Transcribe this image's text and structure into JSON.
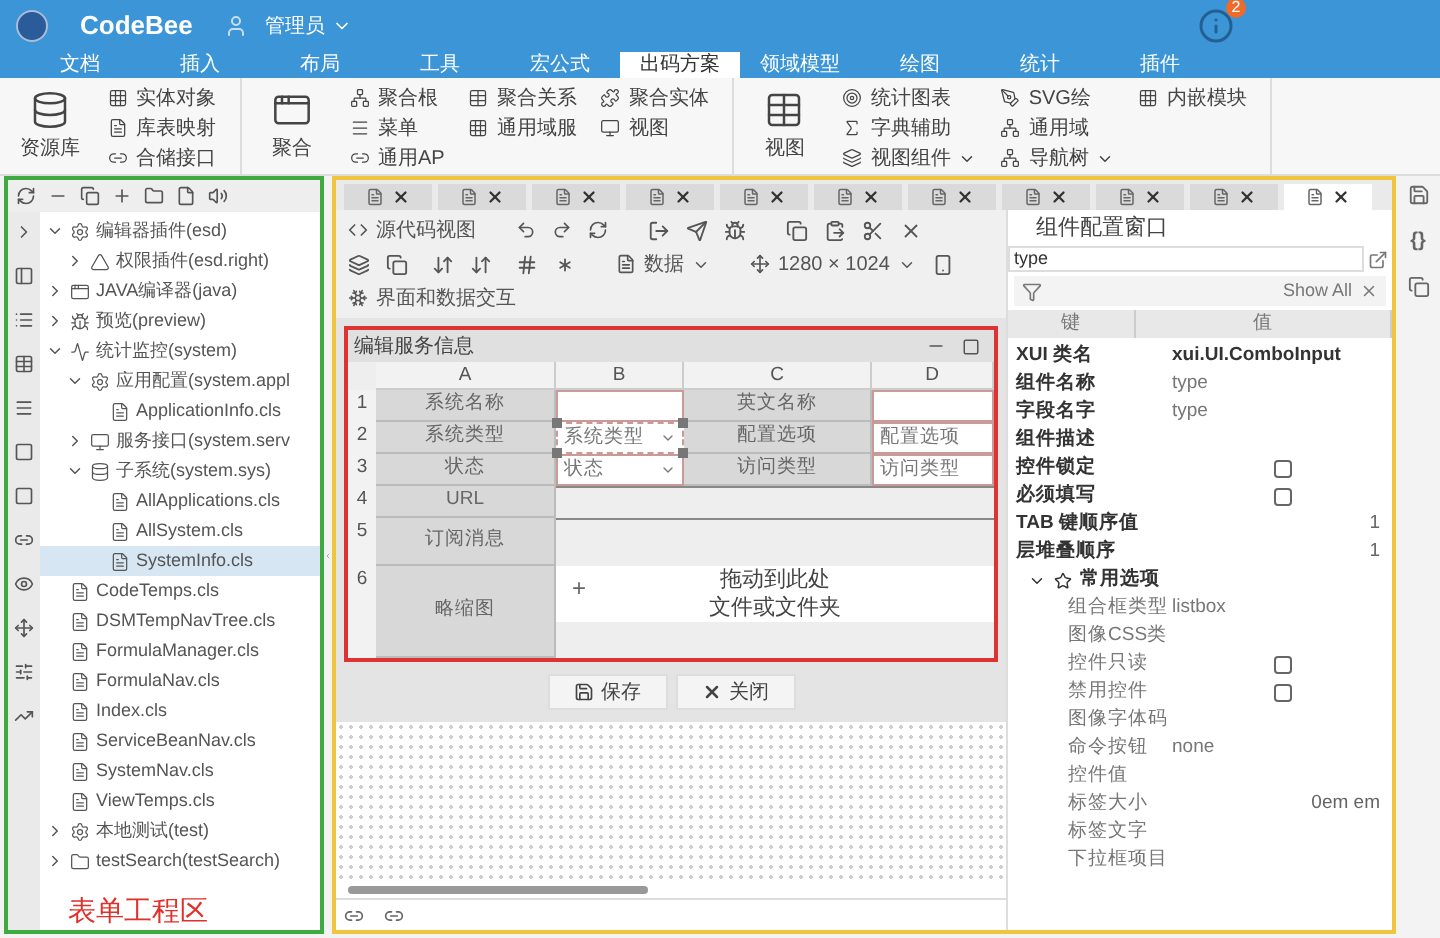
{
  "header": {
    "app_name": "CodeBee",
    "user": "管理员",
    "notification_count": "2"
  },
  "ribbon": {
    "tabs": [
      {
        "label": "文档",
        "selected": false
      },
      {
        "label": "插入",
        "selected": false
      },
      {
        "label": "布局",
        "selected": false
      },
      {
        "label": "工具",
        "selected": false
      },
      {
        "label": "宏公式",
        "selected": false
      },
      {
        "label": "出码方案",
        "selected": true
      },
      {
        "label": "领域模型",
        "selected": false
      },
      {
        "label": "绘图",
        "selected": false
      },
      {
        "label": "统计",
        "selected": false
      },
      {
        "label": "插件",
        "selected": false
      }
    ],
    "groups": [
      {
        "large": {
          "label": "资源库"
        },
        "columns": [
          [
            {
              "label": "实体对象",
              "dropdown": false
            },
            {
              "label": "库表映射",
              "dropdown": false
            },
            {
              "label": "合储接口",
              "dropdown": false
            }
          ]
        ]
      },
      {
        "large": {
          "label": "聚合"
        },
        "columns": [
          [
            {
              "label": "聚合根",
              "dropdown": false
            },
            {
              "label": "菜单",
              "dropdown": false
            },
            {
              "label": "通用AP",
              "dropdown": false
            }
          ],
          [
            {
              "label": "聚合关系",
              "dropdown": false
            },
            {
              "label": "通用域服",
              "dropdown": false
            }
          ],
          [
            {
              "label": "聚合实体",
              "dropdown": false
            },
            {
              "label": "视图",
              "dropdown": false
            }
          ]
        ]
      },
      {
        "large": {
          "label": "视图"
        },
        "columns": [
          [
            {
              "label": "统计图表",
              "dropdown": false
            },
            {
              "label": "字典辅助",
              "dropdown": false
            },
            {
              "label": "视图组件",
              "dropdown": true
            }
          ],
          [
            {
              "label": "SVG绘",
              "dropdown": false
            },
            {
              "label": "通用域",
              "dropdown": false
            },
            {
              "label": "导航树",
              "dropdown": true
            }
          ],
          [
            {
              "label": "内嵌模块",
              "dropdown": false
            }
          ]
        ]
      }
    ]
  },
  "project_tree": {
    "annotation": "表单工程区",
    "items": [
      {
        "label": "编辑器插件(esd)",
        "kind": "plugin",
        "selected": false,
        "expanded": true,
        "children": [
          {
            "label": "权限插件(esd.right)",
            "kind": "permission",
            "selected": false,
            "expanded": false
          }
        ]
      },
      {
        "label": "JAVA编译器(java)",
        "kind": "compiler",
        "selected": false,
        "expanded": false
      },
      {
        "label": "预览(preview)",
        "kind": "preview",
        "selected": false,
        "expanded": false
      },
      {
        "label": "统计监控(system)",
        "kind": "monitoring",
        "selected": false,
        "expanded": true,
        "children": [
          {
            "label": "应用配置(system.appl",
            "kind": "plugin",
            "selected": false,
            "expanded": true,
            "children": [
              {
                "label": "ApplicationInfo.cls",
                "kind": "file",
                "selected": false
              }
            ]
          },
          {
            "label": "服务接口(system.serv",
            "kind": "service",
            "selected": false,
            "expanded": false
          },
          {
            "label": "子系统(system.sys)",
            "kind": "database",
            "selected": false,
            "expanded": true,
            "children": [
              {
                "label": "AllApplications.cls",
                "kind": "file",
                "selected": false
              },
              {
                "label": "AllSystem.cls",
                "kind": "file",
                "selected": false
              },
              {
                "label": "SystemInfo.cls",
                "kind": "file",
                "selected": true
              }
            ]
          }
        ]
      },
      {
        "label": "CodeTemps.cls",
        "kind": "file",
        "selected": false
      },
      {
        "label": "DSMTempNavTree.cls",
        "kind": "file",
        "selected": false
      },
      {
        "label": "FormulaManager.cls",
        "kind": "file",
        "selected": false
      },
      {
        "label": "FormulaNav.cls",
        "kind": "file",
        "selected": false
      },
      {
        "label": "Index.cls",
        "kind": "file",
        "selected": false
      },
      {
        "label": "ServiceBeanNav.cls",
        "kind": "file",
        "selected": false
      },
      {
        "label": "SystemNav.cls",
        "kind": "file",
        "selected": false
      },
      {
        "label": "ViewTemps.cls",
        "kind": "file",
        "selected": false
      },
      {
        "label": "本地测试(test)",
        "kind": "plugin",
        "selected": false,
        "expanded": false
      },
      {
        "label": "testSearch(testSearch)",
        "kind": "folder",
        "selected": false,
        "expanded": false
      }
    ]
  },
  "editor": {
    "tabs": [
      {
        "selected": false
      },
      {
        "selected": false
      },
      {
        "selected": false
      },
      {
        "selected": false
      },
      {
        "selected": false
      },
      {
        "selected": false
      },
      {
        "selected": false
      },
      {
        "selected": false
      },
      {
        "selected": false
      },
      {
        "selected": false
      },
      {
        "selected": true
      }
    ],
    "toolbar": {
      "source_view": "源代码视图",
      "data_menu": "数据",
      "resolution": "1280 × 1024",
      "interaction": "界面和数据交互"
    },
    "form": {
      "title": "编辑服务信息",
      "columns": [
        "A",
        "B",
        "C",
        "D"
      ],
      "rows": [
        {
          "number": "1",
          "cells": [
            {
              "kind": "label",
              "text": "系统名称",
              "selected": false
            },
            {
              "kind": "input",
              "selected": false
            },
            {
              "kind": "label",
              "text": "英文名称",
              "selected": false
            },
            {
              "kind": "input",
              "selected": false
            }
          ]
        },
        {
          "number": "2",
          "cells": [
            {
              "kind": "label",
              "text": "系统类型",
              "selected": false
            },
            {
              "kind": "select",
              "placeholder": "系统类型",
              "selected": true
            },
            {
              "kind": "label",
              "text": "配置选项",
              "selected": false
            },
            {
              "kind": "input",
              "placeholder": "配置选项",
              "selected": false
            }
          ]
        },
        {
          "number": "3",
          "cells": [
            {
              "kind": "label",
              "text": "状态",
              "selected": false
            },
            {
              "kind": "select",
              "placeholder": "状态",
              "selected": false
            },
            {
              "kind": "label",
              "text": "访问类型",
              "selected": false
            },
            {
              "kind": "input",
              "placeholder": "访问类型",
              "selected": false
            }
          ]
        },
        {
          "number": "4",
          "cells": [
            {
              "kind": "label",
              "text": "URL",
              "selected": false
            },
            {
              "kind": "wide_input",
              "selected": false
            }
          ]
        },
        {
          "number": "5",
          "cells": [
            {
              "kind": "label",
              "text": "订阅消息",
              "selected": false
            },
            {
              "kind": "wide_input",
              "selected": false
            }
          ]
        },
        {
          "number": "6",
          "cells": [
            {
              "kind": "label",
              "text": "略缩图",
              "selected": false
            },
            {
              "kind": "upload",
              "plus": "+",
              "lines": [
                "拖动到此处",
                "文件或文件夹"
              ],
              "selected": false
            }
          ]
        }
      ]
    },
    "buttons": [
      {
        "label": "保存",
        "kind": "save"
      },
      {
        "label": "关闭",
        "kind": "close"
      }
    ]
  },
  "properties": {
    "title": "组件配置窗口",
    "search": {
      "value": "type"
    },
    "filter": {
      "show_all": "Show All"
    },
    "columns": [
      "键",
      "值"
    ],
    "rows": [
      {
        "kind": "class",
        "key": "XUI 类名",
        "value": "xui.UI.ComboInput"
      },
      {
        "kind": "text",
        "key": "组件名称",
        "value": "type"
      },
      {
        "kind": "text",
        "key": "字段名字",
        "value": "type"
      },
      {
        "kind": "text",
        "key": "组件描述"
      },
      {
        "kind": "check",
        "key": "控件锁定",
        "checked": false
      },
      {
        "kind": "check",
        "key": "必须填写",
        "checked": false
      },
      {
        "kind": "number",
        "key": "TAB 键顺序值",
        "value": "1"
      },
      {
        "kind": "number",
        "key": "层堆叠顺序",
        "value": "1"
      },
      {
        "kind": "section",
        "key": "常用选项",
        "expanded": true,
        "children": [
          {
            "kind": "text",
            "key": "组合框类型",
            "value": "listbox"
          },
          {
            "kind": "text",
            "key": "图像CSS类"
          },
          {
            "kind": "check",
            "key": "控件只读",
            "checked": false
          },
          {
            "kind": "check",
            "key": "禁用控件",
            "checked": false
          },
          {
            "kind": "text",
            "key": "图像字体码"
          },
          {
            "kind": "text",
            "key": "命令按钮",
            "value": "none"
          },
          {
            "kind": "text",
            "key": "控件值"
          },
          {
            "kind": "number",
            "key": "标签大小",
            "value": "0em em"
          },
          {
            "kind": "text",
            "key": "标签文字"
          },
          {
            "kind": "text",
            "key": "下拉框项目"
          }
        ]
      }
    ]
  },
  "side_strip": {
    "code_label": "{}"
  }
}
